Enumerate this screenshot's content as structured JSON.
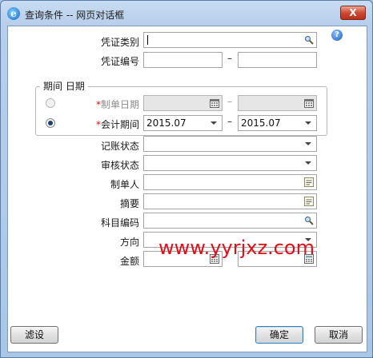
{
  "window": {
    "title": "查询条件 -- 网页对话框",
    "close_label": "X"
  },
  "help": {
    "label": "?"
  },
  "form": {
    "voucher_type": {
      "label": "凭证类别",
      "value": ""
    },
    "voucher_no": {
      "label": "凭证编号",
      "from": "",
      "to": "",
      "dash": "–"
    },
    "period_group": {
      "title": "期间 日期"
    },
    "make_date": {
      "star": "*",
      "label": "制单日期",
      "from": "",
      "to": "",
      "dash": "–"
    },
    "account_period": {
      "star": "*",
      "label": "会计期间",
      "from": "2015.07",
      "to": "2015.07",
      "dash": "–"
    },
    "posting_status": {
      "label": "记账状态",
      "value": ""
    },
    "audit_status": {
      "label": "审核状态",
      "value": ""
    },
    "maker": {
      "label": "制单人",
      "value": ""
    },
    "summary": {
      "label": "摘要",
      "value": ""
    },
    "subject_code": {
      "label": "科目编码",
      "value": ""
    },
    "direction": {
      "label": "方向",
      "value": ""
    },
    "amount": {
      "label": "金额",
      "from": "",
      "to": ""
    }
  },
  "buttons": {
    "filter": "滤设",
    "ok": "确定",
    "cancel": "取消"
  },
  "watermark": {
    "text": "www.yyrjxz.com"
  }
}
